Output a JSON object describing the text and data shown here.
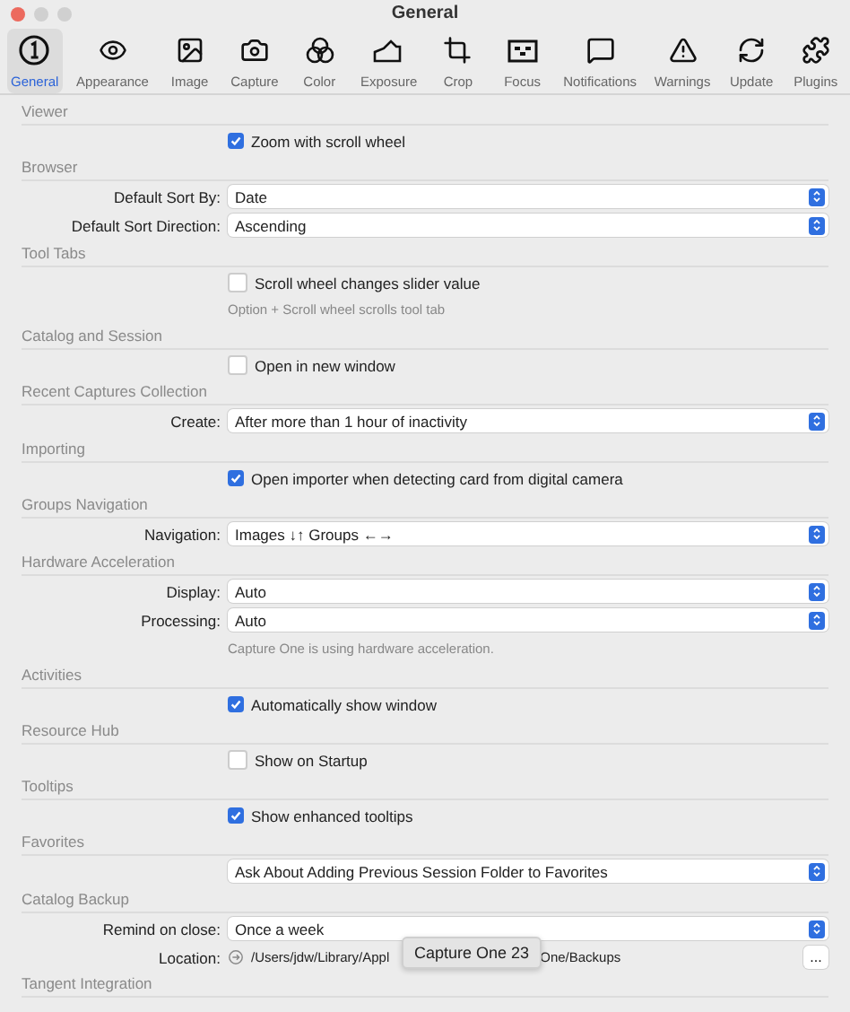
{
  "window": {
    "title": "General"
  },
  "toolbar": [
    {
      "label": "General",
      "selected": true
    },
    {
      "label": "Appearance",
      "selected": false
    },
    {
      "label": "Image",
      "selected": false
    },
    {
      "label": "Capture",
      "selected": false
    },
    {
      "label": "Color",
      "selected": false
    },
    {
      "label": "Exposure",
      "selected": false
    },
    {
      "label": "Crop",
      "selected": false
    },
    {
      "label": "Focus",
      "selected": false
    },
    {
      "label": "Notifications",
      "selected": false
    },
    {
      "label": "Warnings",
      "selected": false
    },
    {
      "label": "Update",
      "selected": false
    },
    {
      "label": "Plugins",
      "selected": false
    }
  ],
  "sections": [
    {
      "title": "Viewer",
      "rows": [
        {
          "kind": "checkbox",
          "label": "Zoom with scroll wheel",
          "checked": true
        }
      ]
    },
    {
      "title": "Browser",
      "rows": [
        {
          "kind": "select",
          "label": "Default Sort By:",
          "value": "Date"
        },
        {
          "kind": "select",
          "label": "Default Sort Direction:",
          "value": "Ascending"
        }
      ]
    },
    {
      "title": "Tool Tabs",
      "rows": [
        {
          "kind": "checkbox",
          "label": "Scroll wheel changes slider value",
          "checked": false
        },
        {
          "kind": "note",
          "text": "Option + Scroll wheel scrolls tool tab"
        }
      ]
    },
    {
      "title": "Catalog and Session",
      "rows": [
        {
          "kind": "checkbox",
          "label": "Open in new window",
          "checked": false
        }
      ]
    },
    {
      "title": "Recent Captures Collection",
      "rows": [
        {
          "kind": "select",
          "label": "Create:",
          "value": "After more than 1 hour of inactivity"
        }
      ]
    },
    {
      "title": "Importing",
      "rows": [
        {
          "kind": "checkbox",
          "label": "Open importer when detecting card from digital camera",
          "checked": true
        }
      ]
    },
    {
      "title": "Groups Navigation",
      "rows": [
        {
          "kind": "select",
          "label": "Navigation:",
          "value": "Images ↓↑ Groups ←→"
        }
      ]
    },
    {
      "title": "Hardware Acceleration",
      "rows": [
        {
          "kind": "select",
          "label": "Display:",
          "value": "Auto"
        },
        {
          "kind": "select",
          "label": "Processing:",
          "value": "Auto"
        },
        {
          "kind": "note",
          "text": "Capture One is using hardware acceleration."
        }
      ]
    },
    {
      "title": "Activities",
      "rows": [
        {
          "kind": "checkbox",
          "label": "Automatically show window",
          "checked": true
        }
      ]
    },
    {
      "title": "Resource Hub",
      "rows": [
        {
          "kind": "checkbox",
          "label": "Show on Startup",
          "checked": false
        }
      ]
    },
    {
      "title": "Tooltips",
      "rows": [
        {
          "kind": "checkbox",
          "label": "Show enhanced tooltips",
          "checked": true
        }
      ]
    },
    {
      "title": "Favorites",
      "rows": [
        {
          "kind": "select",
          "value": "Ask About Adding Previous Session Folder to Favorites"
        }
      ]
    },
    {
      "title": "Catalog Backup",
      "rows": [
        {
          "kind": "select",
          "label": "Remind on close:",
          "value": "Once a week"
        },
        {
          "kind": "path",
          "label": "Location:",
          "path_start": "/Users/jdw/Library/Appl",
          "path_end": "One/Backups",
          "button": "...",
          "tooltip": "Capture One 23"
        }
      ]
    },
    {
      "title": "Tangent Integration"
    }
  ]
}
